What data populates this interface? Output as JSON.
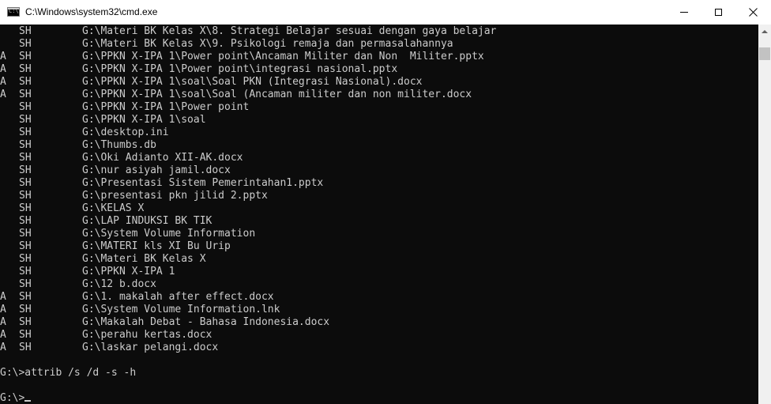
{
  "window": {
    "title": "C:\\Windows\\system32\\cmd.exe",
    "icon_glyph": "C:\\"
  },
  "console": {
    "listing": [
      {
        "a": "",
        "sh": "SH",
        "path": "G:\\Materi BK Kelas X\\8. Strategi Belajar sesuai dengan gaya belajar"
      },
      {
        "a": "",
        "sh": "SH",
        "path": "G:\\Materi BK Kelas X\\9. Psikologi remaja dan permasalahannya"
      },
      {
        "a": "A",
        "sh": "SH",
        "path": "G:\\PPKN X-IPA 1\\Power point\\Ancaman Militer dan Non  Militer.pptx"
      },
      {
        "a": "A",
        "sh": "SH",
        "path": "G:\\PPKN X-IPA 1\\Power point\\integrasi nasional.pptx"
      },
      {
        "a": "A",
        "sh": "SH",
        "path": "G:\\PPKN X-IPA 1\\soal\\Soal PKN (Integrasi Nasional).docx"
      },
      {
        "a": "A",
        "sh": "SH",
        "path": "G:\\PPKN X-IPA 1\\soal\\Soal (Ancaman militer dan non militer.docx"
      },
      {
        "a": "",
        "sh": "SH",
        "path": "G:\\PPKN X-IPA 1\\Power point"
      },
      {
        "a": "",
        "sh": "SH",
        "path": "G:\\PPKN X-IPA 1\\soal"
      },
      {
        "a": "",
        "sh": "SH",
        "path": "G:\\desktop.ini"
      },
      {
        "a": "",
        "sh": "SH",
        "path": "G:\\Thumbs.db"
      },
      {
        "a": "",
        "sh": "SH",
        "path": "G:\\Oki Adianto XII-AK.docx"
      },
      {
        "a": "",
        "sh": "SH",
        "path": "G:\\nur asiyah jamil.docx"
      },
      {
        "a": "",
        "sh": "SH",
        "path": "G:\\Presentasi Sistem Pemerintahan1.pptx"
      },
      {
        "a": "",
        "sh": "SH",
        "path": "G:\\presentasi pkn jilid 2.pptx"
      },
      {
        "a": "",
        "sh": "SH",
        "path": "G:\\KELAS X"
      },
      {
        "a": "",
        "sh": "SH",
        "path": "G:\\LAP INDUKSI BK TIK"
      },
      {
        "a": "",
        "sh": "SH",
        "path": "G:\\System Volume Information"
      },
      {
        "a": "",
        "sh": "SH",
        "path": "G:\\MATERI kls XI Bu Urip"
      },
      {
        "a": "",
        "sh": "SH",
        "path": "G:\\Materi BK Kelas X"
      },
      {
        "a": "",
        "sh": "SH",
        "path": "G:\\PPKN X-IPA 1"
      },
      {
        "a": "",
        "sh": "SH",
        "path": "G:\\12 b.docx"
      },
      {
        "a": "A",
        "sh": "SH",
        "path": "G:\\1. makalah after effect.docx"
      },
      {
        "a": "A",
        "sh": "SH",
        "path": "G:\\System Volume Information.lnk"
      },
      {
        "a": "A",
        "sh": "SH",
        "path": "G:\\Makalah Debat - Bahasa Indonesia.docx"
      },
      {
        "a": "A",
        "sh": "SH",
        "path": "G:\\perahu kertas.docx"
      },
      {
        "a": "A",
        "sh": "SH",
        "path": "G:\\laskar pelangi.docx"
      }
    ],
    "command": "G:\\>attrib /s /d -s -h",
    "prompt": "G:\\>"
  },
  "colors": {
    "console_bg": "#0c0c0c",
    "console_fg": "#cccccc",
    "titlebar_bg": "#ffffff",
    "scrollbar_bg": "#f0f0f0",
    "scrollbar_thumb": "#c2c2c2"
  },
  "icons": {
    "app": "cmd-console-icon",
    "minimize": "minimize-icon",
    "maximize": "maximize-icon",
    "close": "close-icon",
    "scroll_up": "chevron-up-icon"
  }
}
